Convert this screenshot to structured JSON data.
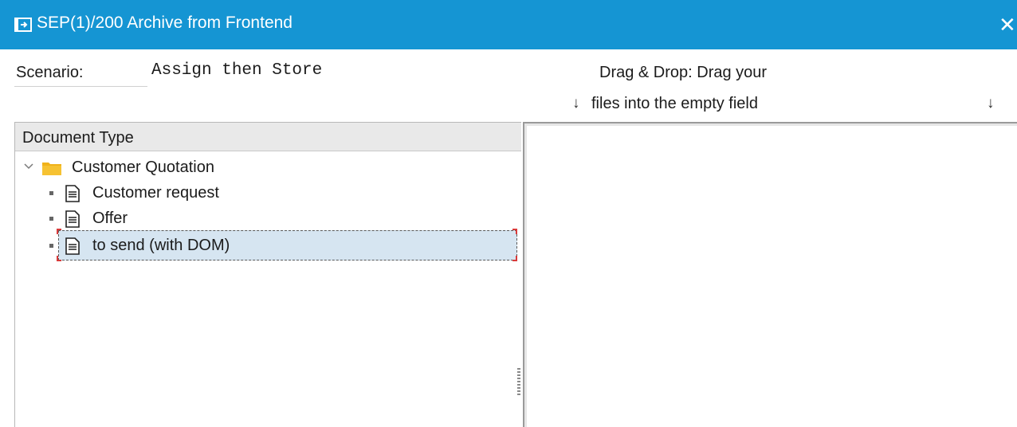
{
  "window": {
    "title": "SEP(1)/200 Archive from Frontend",
    "close_glyph": "✕"
  },
  "scenario": {
    "label": "Scenario:",
    "value": "Assign then Store"
  },
  "drag_drop": {
    "line1": "Drag & Drop: Drag your",
    "line2": "files into the empty field",
    "arrow_glyph": "↓"
  },
  "tree": {
    "header": "Document Type",
    "root": {
      "label": "Customer Quotation",
      "icon": "folder-icon",
      "expanded": true
    },
    "children": [
      {
        "label": "Customer request",
        "icon": "document-icon"
      },
      {
        "label": "Offer",
        "icon": "document-icon"
      },
      {
        "label": "to send (with DOM)",
        "icon": "document-icon",
        "selected": true
      }
    ]
  },
  "colors": {
    "title_bar": "#1595d3",
    "selection": "#d6e5f1",
    "folder": "#f0b21a",
    "focus_corner": "#d93a3a"
  }
}
